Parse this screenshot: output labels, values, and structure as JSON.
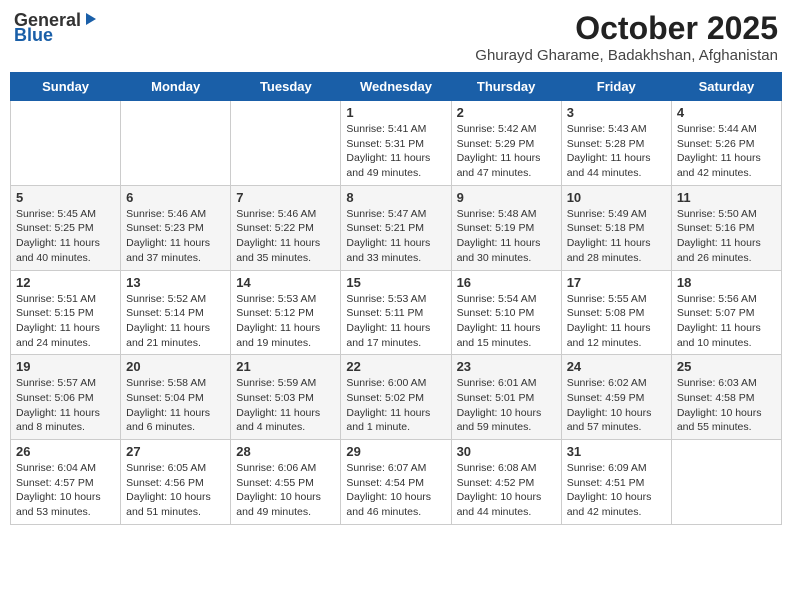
{
  "header": {
    "logo_general": "General",
    "logo_blue": "Blue",
    "title": "October 2025",
    "location": "Ghurayd Gharame, Badakhshan, Afghanistan"
  },
  "days_of_week": [
    "Sunday",
    "Monday",
    "Tuesday",
    "Wednesday",
    "Thursday",
    "Friday",
    "Saturday"
  ],
  "weeks": [
    [
      {
        "day": "",
        "info": ""
      },
      {
        "day": "",
        "info": ""
      },
      {
        "day": "",
        "info": ""
      },
      {
        "day": "1",
        "info": "Sunrise: 5:41 AM\nSunset: 5:31 PM\nDaylight: 11 hours and 49 minutes."
      },
      {
        "day": "2",
        "info": "Sunrise: 5:42 AM\nSunset: 5:29 PM\nDaylight: 11 hours and 47 minutes."
      },
      {
        "day": "3",
        "info": "Sunrise: 5:43 AM\nSunset: 5:28 PM\nDaylight: 11 hours and 44 minutes."
      },
      {
        "day": "4",
        "info": "Sunrise: 5:44 AM\nSunset: 5:26 PM\nDaylight: 11 hours and 42 minutes."
      }
    ],
    [
      {
        "day": "5",
        "info": "Sunrise: 5:45 AM\nSunset: 5:25 PM\nDaylight: 11 hours and 40 minutes."
      },
      {
        "day": "6",
        "info": "Sunrise: 5:46 AM\nSunset: 5:23 PM\nDaylight: 11 hours and 37 minutes."
      },
      {
        "day": "7",
        "info": "Sunrise: 5:46 AM\nSunset: 5:22 PM\nDaylight: 11 hours and 35 minutes."
      },
      {
        "day": "8",
        "info": "Sunrise: 5:47 AM\nSunset: 5:21 PM\nDaylight: 11 hours and 33 minutes."
      },
      {
        "day": "9",
        "info": "Sunrise: 5:48 AM\nSunset: 5:19 PM\nDaylight: 11 hours and 30 minutes."
      },
      {
        "day": "10",
        "info": "Sunrise: 5:49 AM\nSunset: 5:18 PM\nDaylight: 11 hours and 28 minutes."
      },
      {
        "day": "11",
        "info": "Sunrise: 5:50 AM\nSunset: 5:16 PM\nDaylight: 11 hours and 26 minutes."
      }
    ],
    [
      {
        "day": "12",
        "info": "Sunrise: 5:51 AM\nSunset: 5:15 PM\nDaylight: 11 hours and 24 minutes."
      },
      {
        "day": "13",
        "info": "Sunrise: 5:52 AM\nSunset: 5:14 PM\nDaylight: 11 hours and 21 minutes."
      },
      {
        "day": "14",
        "info": "Sunrise: 5:53 AM\nSunset: 5:12 PM\nDaylight: 11 hours and 19 minutes."
      },
      {
        "day": "15",
        "info": "Sunrise: 5:53 AM\nSunset: 5:11 PM\nDaylight: 11 hours and 17 minutes."
      },
      {
        "day": "16",
        "info": "Sunrise: 5:54 AM\nSunset: 5:10 PM\nDaylight: 11 hours and 15 minutes."
      },
      {
        "day": "17",
        "info": "Sunrise: 5:55 AM\nSunset: 5:08 PM\nDaylight: 11 hours and 12 minutes."
      },
      {
        "day": "18",
        "info": "Sunrise: 5:56 AM\nSunset: 5:07 PM\nDaylight: 11 hours and 10 minutes."
      }
    ],
    [
      {
        "day": "19",
        "info": "Sunrise: 5:57 AM\nSunset: 5:06 PM\nDaylight: 11 hours and 8 minutes."
      },
      {
        "day": "20",
        "info": "Sunrise: 5:58 AM\nSunset: 5:04 PM\nDaylight: 11 hours and 6 minutes."
      },
      {
        "day": "21",
        "info": "Sunrise: 5:59 AM\nSunset: 5:03 PM\nDaylight: 11 hours and 4 minutes."
      },
      {
        "day": "22",
        "info": "Sunrise: 6:00 AM\nSunset: 5:02 PM\nDaylight: 11 hours and 1 minute."
      },
      {
        "day": "23",
        "info": "Sunrise: 6:01 AM\nSunset: 5:01 PM\nDaylight: 10 hours and 59 minutes."
      },
      {
        "day": "24",
        "info": "Sunrise: 6:02 AM\nSunset: 4:59 PM\nDaylight: 10 hours and 57 minutes."
      },
      {
        "day": "25",
        "info": "Sunrise: 6:03 AM\nSunset: 4:58 PM\nDaylight: 10 hours and 55 minutes."
      }
    ],
    [
      {
        "day": "26",
        "info": "Sunrise: 6:04 AM\nSunset: 4:57 PM\nDaylight: 10 hours and 53 minutes."
      },
      {
        "day": "27",
        "info": "Sunrise: 6:05 AM\nSunset: 4:56 PM\nDaylight: 10 hours and 51 minutes."
      },
      {
        "day": "28",
        "info": "Sunrise: 6:06 AM\nSunset: 4:55 PM\nDaylight: 10 hours and 49 minutes."
      },
      {
        "day": "29",
        "info": "Sunrise: 6:07 AM\nSunset: 4:54 PM\nDaylight: 10 hours and 46 minutes."
      },
      {
        "day": "30",
        "info": "Sunrise: 6:08 AM\nSunset: 4:52 PM\nDaylight: 10 hours and 44 minutes."
      },
      {
        "day": "31",
        "info": "Sunrise: 6:09 AM\nSunset: 4:51 PM\nDaylight: 10 hours and 42 minutes."
      },
      {
        "day": "",
        "info": ""
      }
    ]
  ]
}
